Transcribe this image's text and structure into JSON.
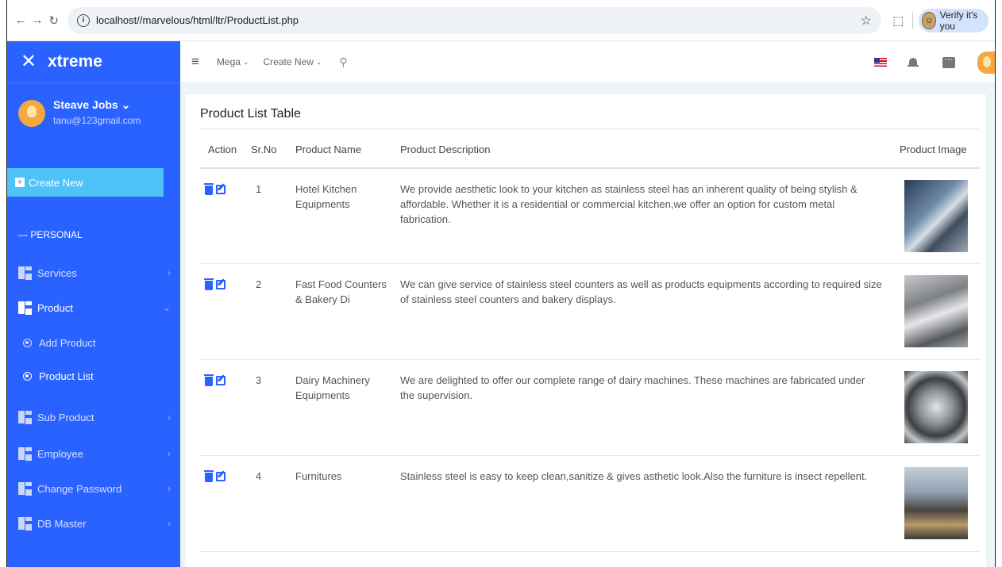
{
  "browser": {
    "url": "localhost//marvelous/html/ltr/ProductList.php",
    "verify_label": "Verify it's you"
  },
  "sidebar": {
    "brand": "xtreme",
    "user_name": "Steave Jobs ⌄",
    "user_email": "tanu@123gmail.com",
    "create_new": "Create New",
    "section": "— PERSONAL",
    "items": [
      {
        "label": "Services",
        "chevron": "›"
      },
      {
        "label": "Product",
        "chevron": "⌄"
      },
      {
        "label": "Sub Product",
        "chevron": "›"
      },
      {
        "label": "Employee",
        "chevron": "›"
      },
      {
        "label": "Change Password",
        "chevron": "›"
      },
      {
        "label": "DB Master",
        "chevron": "›"
      }
    ],
    "subitems": [
      {
        "label": "Add Product"
      },
      {
        "label": "Product List"
      }
    ]
  },
  "topbar": {
    "mega": "Mega",
    "create_new": "Create New",
    "chevron": "⌄"
  },
  "table": {
    "title": "Product List Table",
    "headers": [
      "Action",
      "Sr.No",
      "Product Name",
      "Product Description",
      "Product Image"
    ],
    "rows": [
      {
        "sr": "1",
        "name": "Hotel Kitchen Equipments",
        "description": "We provide aesthetic look to your kitchen as stainless steel has an inherent quality of being stylish & affordable. Whether it is a residential or commercial kitchen,we offer an option for custom metal fabrication.",
        "image": "kitchen-equipment-photo"
      },
      {
        "sr": "2",
        "name": "Fast Food Counters & Bakery Di",
        "description": "We can give service of stainless steel counters as well as products equipments according to required size of stainless steel counters and bakery displays.",
        "image": "food-counter-photo"
      },
      {
        "sr": "3",
        "name": "Dairy Machinery Equipments",
        "description": "We are delighted to offer our complete range of dairy machines. These machines are fabricated under the supervision.",
        "image": "dairy-machine-photo"
      },
      {
        "sr": "4",
        "name": "Furnitures",
        "description": "Stainless steel is easy to keep clean,sanitize & gives asthetic look.Also the furniture is insect repellent.",
        "image": "furniture-photo"
      }
    ]
  },
  "colors": {
    "sidebar": "#2962ff",
    "create_button": "#4fc3f7",
    "content_bg": "#eef5f9",
    "action_icons": "#2962ff"
  }
}
